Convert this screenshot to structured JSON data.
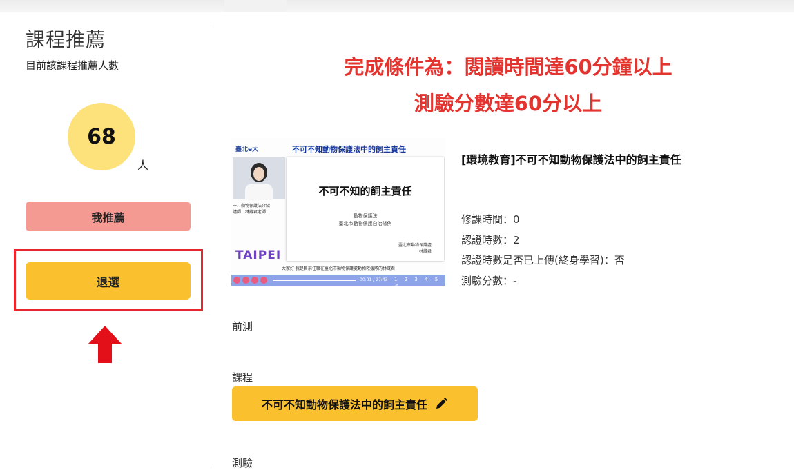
{
  "sidebar": {
    "title": "課程推薦",
    "subtitle": "目前該課程推薦人數",
    "count": "68",
    "count_unit": "人",
    "recommend_label": "我推薦",
    "withdraw_label": "退選"
  },
  "requirements": {
    "line1": "完成條件為：閱讀時間達60分鐘以上",
    "line2": "測驗分數達60分以上"
  },
  "thumbnail": {
    "header_logo": "臺北e大",
    "header_title": "不可不知動物保護法中的飼主責任",
    "slide_title": "不可不知的飼主責任",
    "slide_sub1": "動物保護法",
    "slide_sub2": "臺北市動物保護自治條例",
    "slide_org1": "臺北市動物保護處",
    "slide_org2": "林蔵君",
    "side_text1": "一、動物保護法介紹",
    "side_text2": "講師：林蔵君老師",
    "brand": "TAIPEI",
    "caption": "大家好 我是目前任職在臺北市動物保護處動物救援隊的林蔵君",
    "time": "00:01 / 27:43",
    "pages": "1 2 3 4 5 >"
  },
  "course": {
    "title": "[環境教育]不可不知動物保護法中的飼主責任",
    "study_time": "修課時間：0",
    "cert_hours": "認證時數：2",
    "uploaded": "認證時數是否已上傳(終身學習)：否",
    "score": "測驗分數：-"
  },
  "sections": {
    "pretest": "前測",
    "course": "課程",
    "course_button": "不可不知動物保護法中的飼主責任",
    "exam": "測驗"
  },
  "colors": {
    "accent_yellow": "#fbc02d",
    "recommend_pink": "#f59a93",
    "circle_yellow": "#fde27c",
    "alert_red": "#e3342f",
    "highlight_red": "#e8262d"
  }
}
